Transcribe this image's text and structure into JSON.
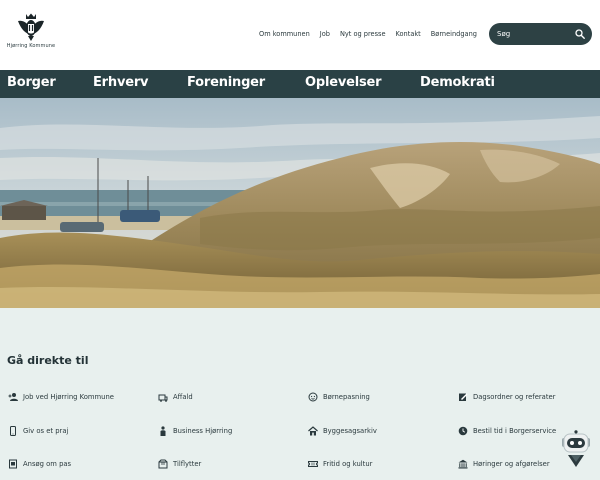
{
  "header": {
    "logo_text": "Hjørring Kommune",
    "links": [
      "Om kommunen",
      "Job",
      "Nyt og presse",
      "Kontakt",
      "Børneindgang"
    ],
    "search": {
      "placeholder": "Søg",
      "icon": "search-icon"
    }
  },
  "nav": {
    "items": [
      "Borger",
      "Erhverv",
      "Foreninger",
      "Oplevelser",
      "Demokrati"
    ]
  },
  "hero": {
    "alt": ""
  },
  "quick_links": {
    "title": "Gå direkte til",
    "items": [
      {
        "label": "Job ved Hjørring Kommune",
        "icon": "person-add-icon"
      },
      {
        "label": "Affald",
        "icon": "trash-truck-icon"
      },
      {
        "label": "Børnepasning",
        "icon": "baby-face-icon"
      },
      {
        "label": "Dagsordner og referater",
        "icon": "edit-document-icon"
      },
      {
        "label": "Giv os et praj",
        "icon": "phone-icon"
      },
      {
        "label": "Business Hjørring",
        "icon": "business-person-icon"
      },
      {
        "label": "Byggesagsarkiv",
        "icon": "house-icon"
      },
      {
        "label": "Bestil tid i Borgerservice",
        "icon": "clock-icon"
      },
      {
        "label": "Ansøg om pas",
        "icon": "passport-icon"
      },
      {
        "label": "Tilflytter",
        "icon": "moving-box-icon"
      },
      {
        "label": "Fritid og kultur",
        "icon": "ticket-icon"
      },
      {
        "label": "Høringer og afgørelser",
        "icon": "town-hall-icon"
      }
    ]
  },
  "colors": {
    "nav_bg": "#2a4145",
    "search_bg": "#2d4144",
    "quick_bg": "#e8f0ee"
  }
}
